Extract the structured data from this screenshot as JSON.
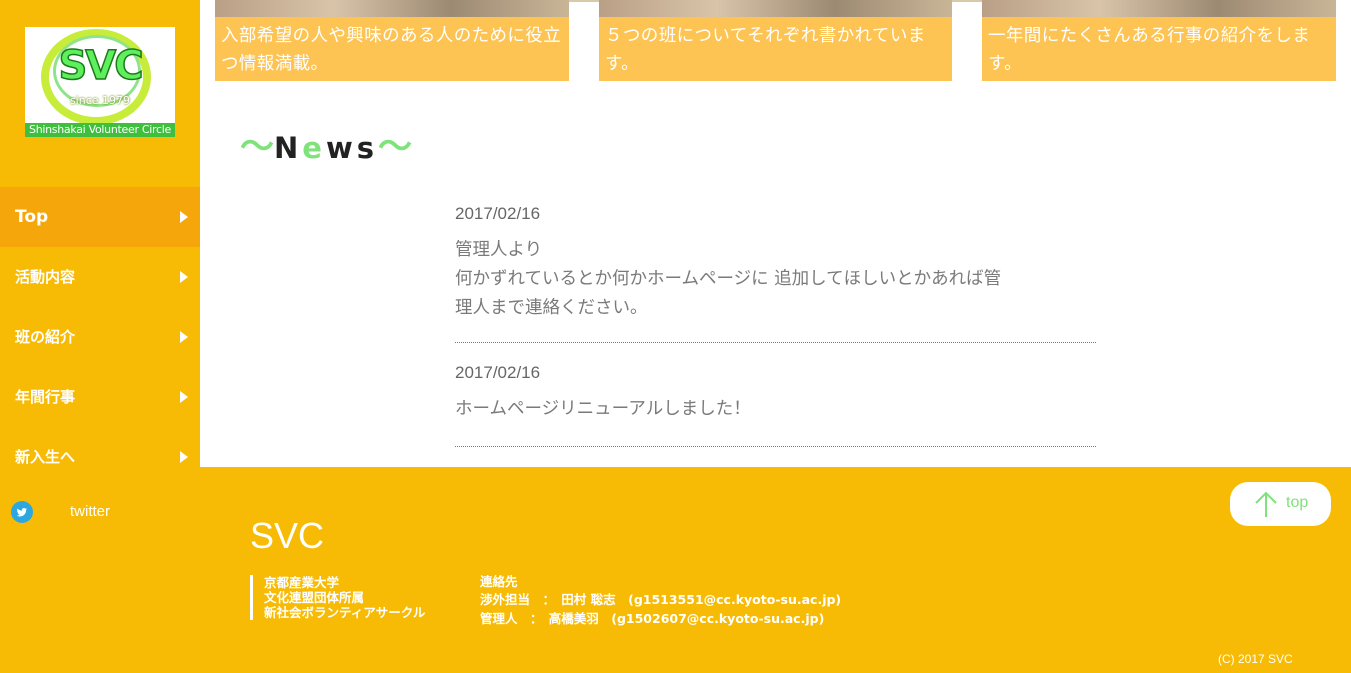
{
  "logo": {
    "text": "SVC",
    "since": "since 1979",
    "circle_name": "Shinshakai Volunteer Circle"
  },
  "nav": {
    "items": [
      {
        "label": "Top",
        "active": true
      },
      {
        "label": "活動内容"
      },
      {
        "label": "班の紹介"
      },
      {
        "label": "年間行事"
      },
      {
        "label": "新入生へ"
      }
    ],
    "twitter_label": "twitter"
  },
  "cards": [
    {
      "text": "入部希望の人や興味のある人のために役立つ情報満載。"
    },
    {
      "text": "５つの班についてそれぞれ書かれています。"
    },
    {
      "text": "一年間にたくさんある行事の紹介をします。"
    }
  ],
  "news": {
    "title_tilde_left": "〜",
    "title_n": "N",
    "title_e": "e",
    "title_ws": "ws",
    "title_tilde_right": "〜",
    "items": [
      {
        "date": "2017/02/16",
        "lines": [
          "管理人より",
          "何かずれているとか何かホームページに 追加してほしいとかあれば管",
          "理人まで連絡ください。"
        ]
      },
      {
        "date": "2017/02/16",
        "lines": [
          "ホームページリニューアルしました！"
        ]
      }
    ]
  },
  "footer": {
    "brand": "SVC",
    "affiliation": [
      "京都産業大学",
      "文化連盟団体所属",
      "新社会ボランティアサークル"
    ],
    "contact_heading": "連絡先",
    "contacts": [
      "渉外担当　：　田村 聡志　(g1513551@cc.kyoto-su.ac.jp)",
      "管理人　：　高橋美羽　(g1502607@cc.kyoto-su.ac.jp)"
    ],
    "copyright": "(C) 2017 SVC",
    "top_button_label": "top"
  },
  "colors": {
    "brand_yellow": "#f7bb06",
    "active_nav": "#f5a60a",
    "card_band": "#fdc454",
    "accent_green": "#7fe27a",
    "twitter_blue": "#2da7e0"
  }
}
